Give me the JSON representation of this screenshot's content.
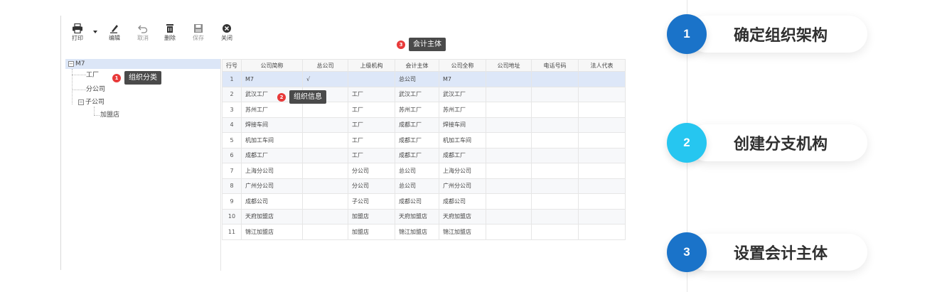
{
  "toolbar": {
    "print": "打印",
    "edit": "编辑",
    "cancel": "取消",
    "delete": "删除",
    "save": "保存",
    "close": "关闭"
  },
  "tree": {
    "root": "M7",
    "factory": "工厂",
    "branch": "分公司",
    "subsidiary": "子公司",
    "franchise": "加盟店"
  },
  "table": {
    "headers": [
      "行号",
      "公司简称",
      "总公司",
      "上级机构",
      "会计主体",
      "公司全称",
      "公司地址",
      "电话号码",
      "法人代表"
    ],
    "rows": [
      [
        "1",
        "M7",
        "√",
        "",
        "总公司",
        "M7",
        "",
        "",
        ""
      ],
      [
        "2",
        "武汉工厂",
        "",
        "工厂",
        "武汉工厂",
        "武汉工厂",
        "",
        "",
        ""
      ],
      [
        "3",
        "苏州工厂",
        "",
        "工厂",
        "苏州工厂",
        "苏州工厂",
        "",
        "",
        ""
      ],
      [
        "4",
        "焊接车间",
        "",
        "工厂",
        "成都工厂",
        "焊接车间",
        "",
        "",
        ""
      ],
      [
        "5",
        "机加工车间",
        "",
        "工厂",
        "成都工厂",
        "机加工车间",
        "",
        "",
        ""
      ],
      [
        "6",
        "成都工厂",
        "",
        "工厂",
        "成都工厂",
        "成都工厂",
        "",
        "",
        ""
      ],
      [
        "7",
        "上海分公司",
        "",
        "分公司",
        "总公司",
        "上海分公司",
        "",
        "",
        ""
      ],
      [
        "8",
        "广州分公司",
        "",
        "分公司",
        "总公司",
        "广州分公司",
        "",
        "",
        ""
      ],
      [
        "9",
        "成都公司",
        "",
        "子公司",
        "成都公司",
        "成都公司",
        "",
        "",
        ""
      ],
      [
        "10",
        "天府加盟店",
        "",
        "加盟店",
        "天府加盟店",
        "天府加盟店",
        "",
        "",
        ""
      ],
      [
        "11",
        "锦江加盟店",
        "",
        "加盟店",
        "锦江加盟店",
        "锦江加盟店",
        "",
        "",
        ""
      ]
    ]
  },
  "callouts": [
    {
      "num": "1",
      "text": "组织分类"
    },
    {
      "num": "2",
      "text": "组织信息"
    },
    {
      "num": "3",
      "text": "会计主体"
    }
  ],
  "steps": [
    {
      "num": "1",
      "title": "确定组织架构",
      "color": "#1a73c9"
    },
    {
      "num": "2",
      "title": "创建分支机构",
      "color": "#26c6f0"
    },
    {
      "num": "3",
      "title": "设置会计主体",
      "color": "#1a73c9"
    }
  ]
}
